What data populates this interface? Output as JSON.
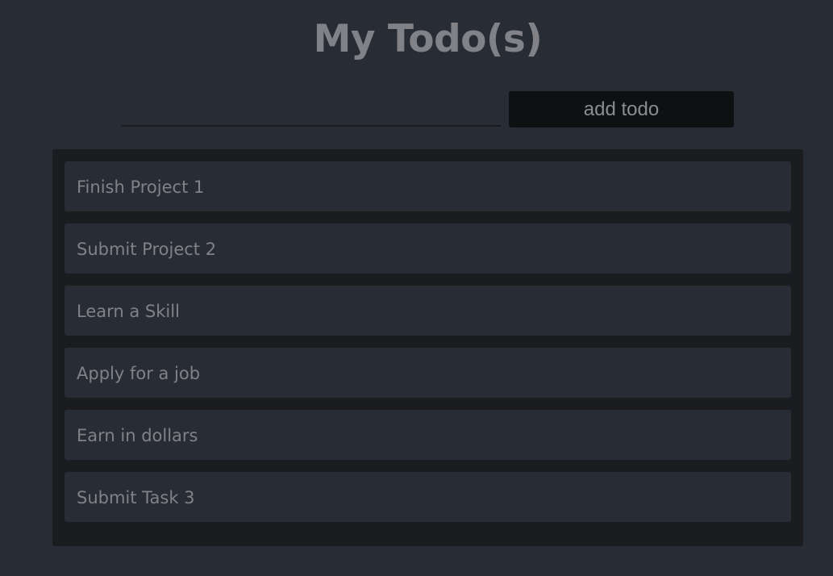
{
  "header": {
    "title": "My Todo(s)"
  },
  "form": {
    "input_value": "",
    "input_placeholder": "",
    "add_label": "add todo"
  },
  "todos": [
    {
      "text": "Finish Project 1"
    },
    {
      "text": "Submit Project 2"
    },
    {
      "text": "Learn a Skill"
    },
    {
      "text": "Apply for a job"
    },
    {
      "text": "Earn in dollars"
    },
    {
      "text": "Submit Task 3"
    }
  ]
}
